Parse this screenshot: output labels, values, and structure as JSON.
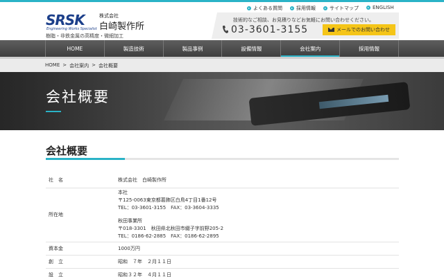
{
  "header": {
    "logo_mark": "SRSK",
    "logo_sub": "Engineering Works Specialist",
    "logo_kabushiki": "株式会社",
    "logo_company": "白崎製作所",
    "tagline": "樹脂・非鉄金属の高精度・微細加工",
    "util_links": [
      {
        "label": "よくある質問"
      },
      {
        "label": "採用情報"
      },
      {
        "label": "サイトマップ"
      },
      {
        "label": "ENGLISH"
      }
    ],
    "contact_text": "技術的なご相談、お見積りなどお気軽にお問い合わせください。",
    "phone": "03-3601-3155",
    "mail_button": "メールでのお問い合わせ"
  },
  "nav": {
    "items": [
      {
        "label": "HOME"
      },
      {
        "label": "製造技術"
      },
      {
        "label": "製品事例"
      },
      {
        "label": "設備情報"
      },
      {
        "label": "会社案内"
      },
      {
        "label": "採用情報"
      }
    ],
    "active_index": 4
  },
  "breadcrumb": [
    "HOME",
    ">",
    "会社案内",
    ">",
    "会社概要"
  ],
  "hero": {
    "title": "会社概要"
  },
  "section": {
    "title": "会社概要"
  },
  "company_info": [
    {
      "label": "社　名",
      "lines": [
        "株式会社　白崎製作所"
      ]
    },
    {
      "label": "所在地",
      "blocks": [
        [
          "本社",
          "〒125-0063東京都葛飾区白鳥4丁目1番12号",
          "TEL：03-3601-3155　FAX：03-3604-3335"
        ],
        [
          "秋田事業所",
          "〒018-3301　秋田県北秋田市綴子字前野205-2",
          "TEL：0186-62-2885　FAX：0186-62-2895"
        ]
      ]
    },
    {
      "label": "資本金",
      "lines": [
        "1000万円"
      ]
    },
    {
      "label": "創　立",
      "lines": [
        "昭和　７年　２月１１日"
      ]
    },
    {
      "label": "設　立",
      "lines": [
        "昭和３２年　４月１１日"
      ]
    }
  ],
  "colors": {
    "accent": "#2ab3c7",
    "nav_bg": "#4a4a4a",
    "button": "#f5c518",
    "brand": "#1c3f8a"
  }
}
